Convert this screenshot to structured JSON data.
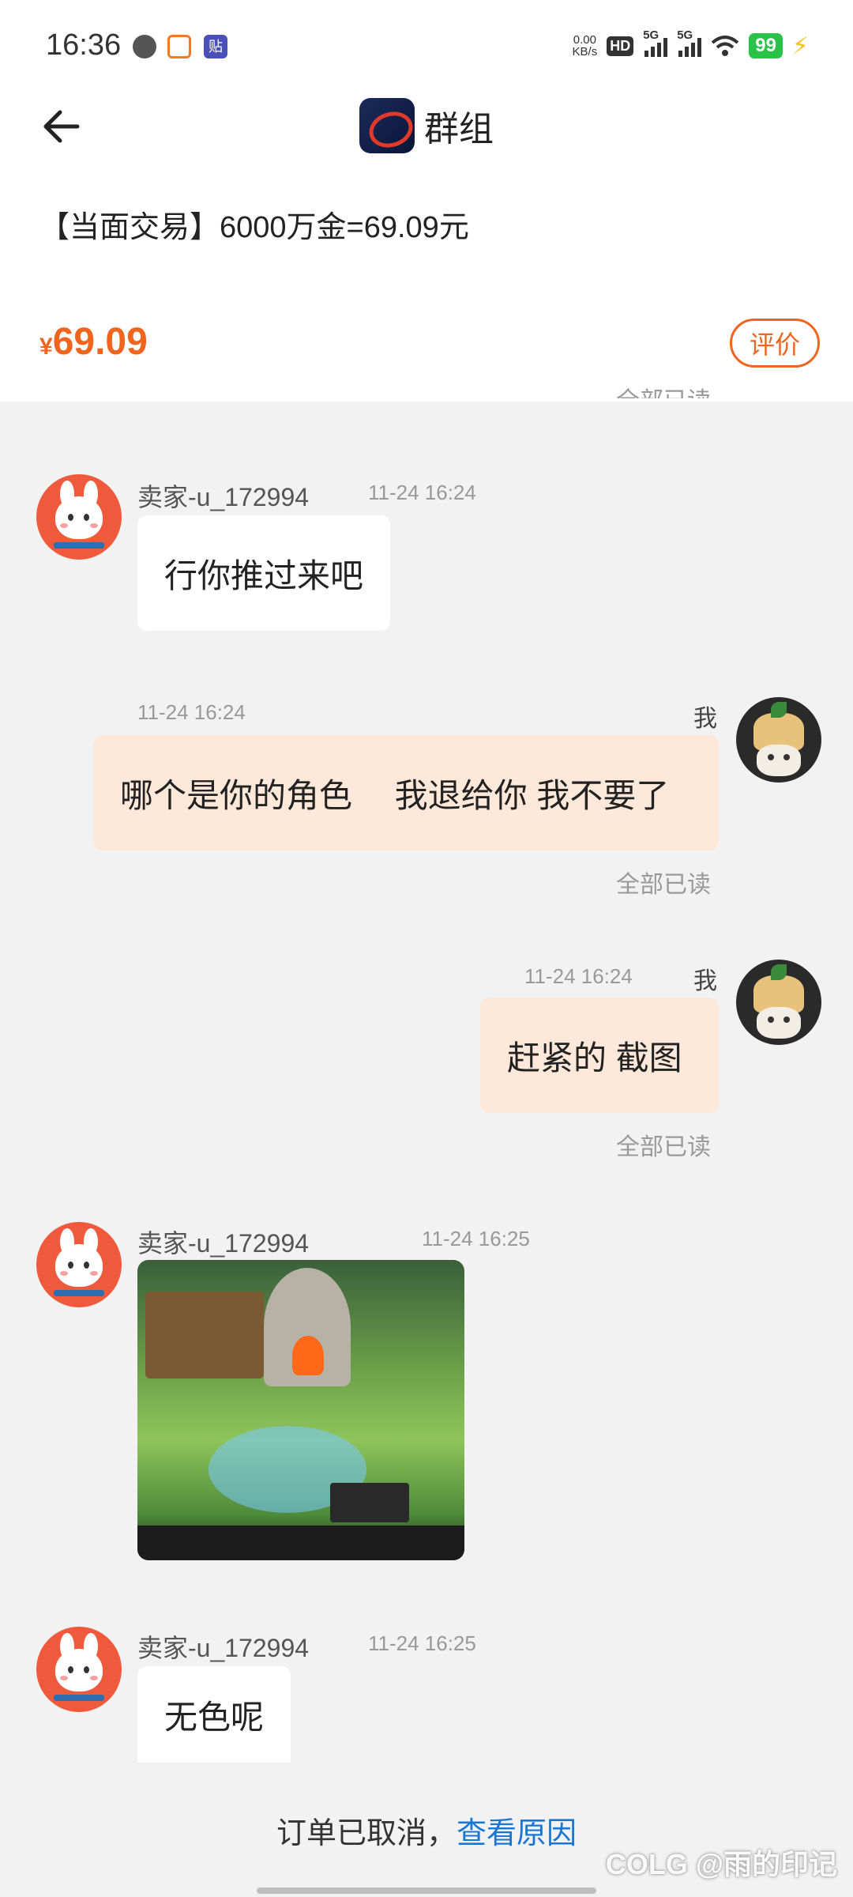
{
  "status_bar": {
    "time": "16:36",
    "net_speed_value": "0.00",
    "net_speed_unit": "KB/s",
    "hd_label": "HD",
    "sim1": "5G",
    "sim2": "5G",
    "battery": "99",
    "app_badge": "贴"
  },
  "header": {
    "title": "群组"
  },
  "product": {
    "title": "【当面交易】6000万金=69.09元",
    "currency": "¥",
    "price": "69.09",
    "rate_label": "评价"
  },
  "partial_read": "全部已读",
  "messages": [
    {
      "sender": "卖家-u_172994",
      "time": "11-24 16:24",
      "text": "行你推过来吧"
    },
    {
      "sender": "我",
      "time": "11-24 16:24",
      "text": "哪个是你的角色　 我退给你 我不要了",
      "read": "全部已读"
    },
    {
      "sender": "我",
      "time": "11-24 16:24",
      "text": "赶紧的 截图",
      "read": "全部已读"
    },
    {
      "sender": "卖家-u_172994",
      "time": "11-24 16:25"
    },
    {
      "sender": "卖家-u_172994",
      "time": "11-24 16:25",
      "text": "无色呢"
    }
  ],
  "footer": {
    "notice": "订单已取消，",
    "link": "查看原因",
    "watermark": "COLG @雨的印记"
  },
  "colors": {
    "accent": "#f0641e",
    "link": "#1976d2",
    "my_bubble": "#fde8da",
    "battery": "#2bc24a"
  }
}
